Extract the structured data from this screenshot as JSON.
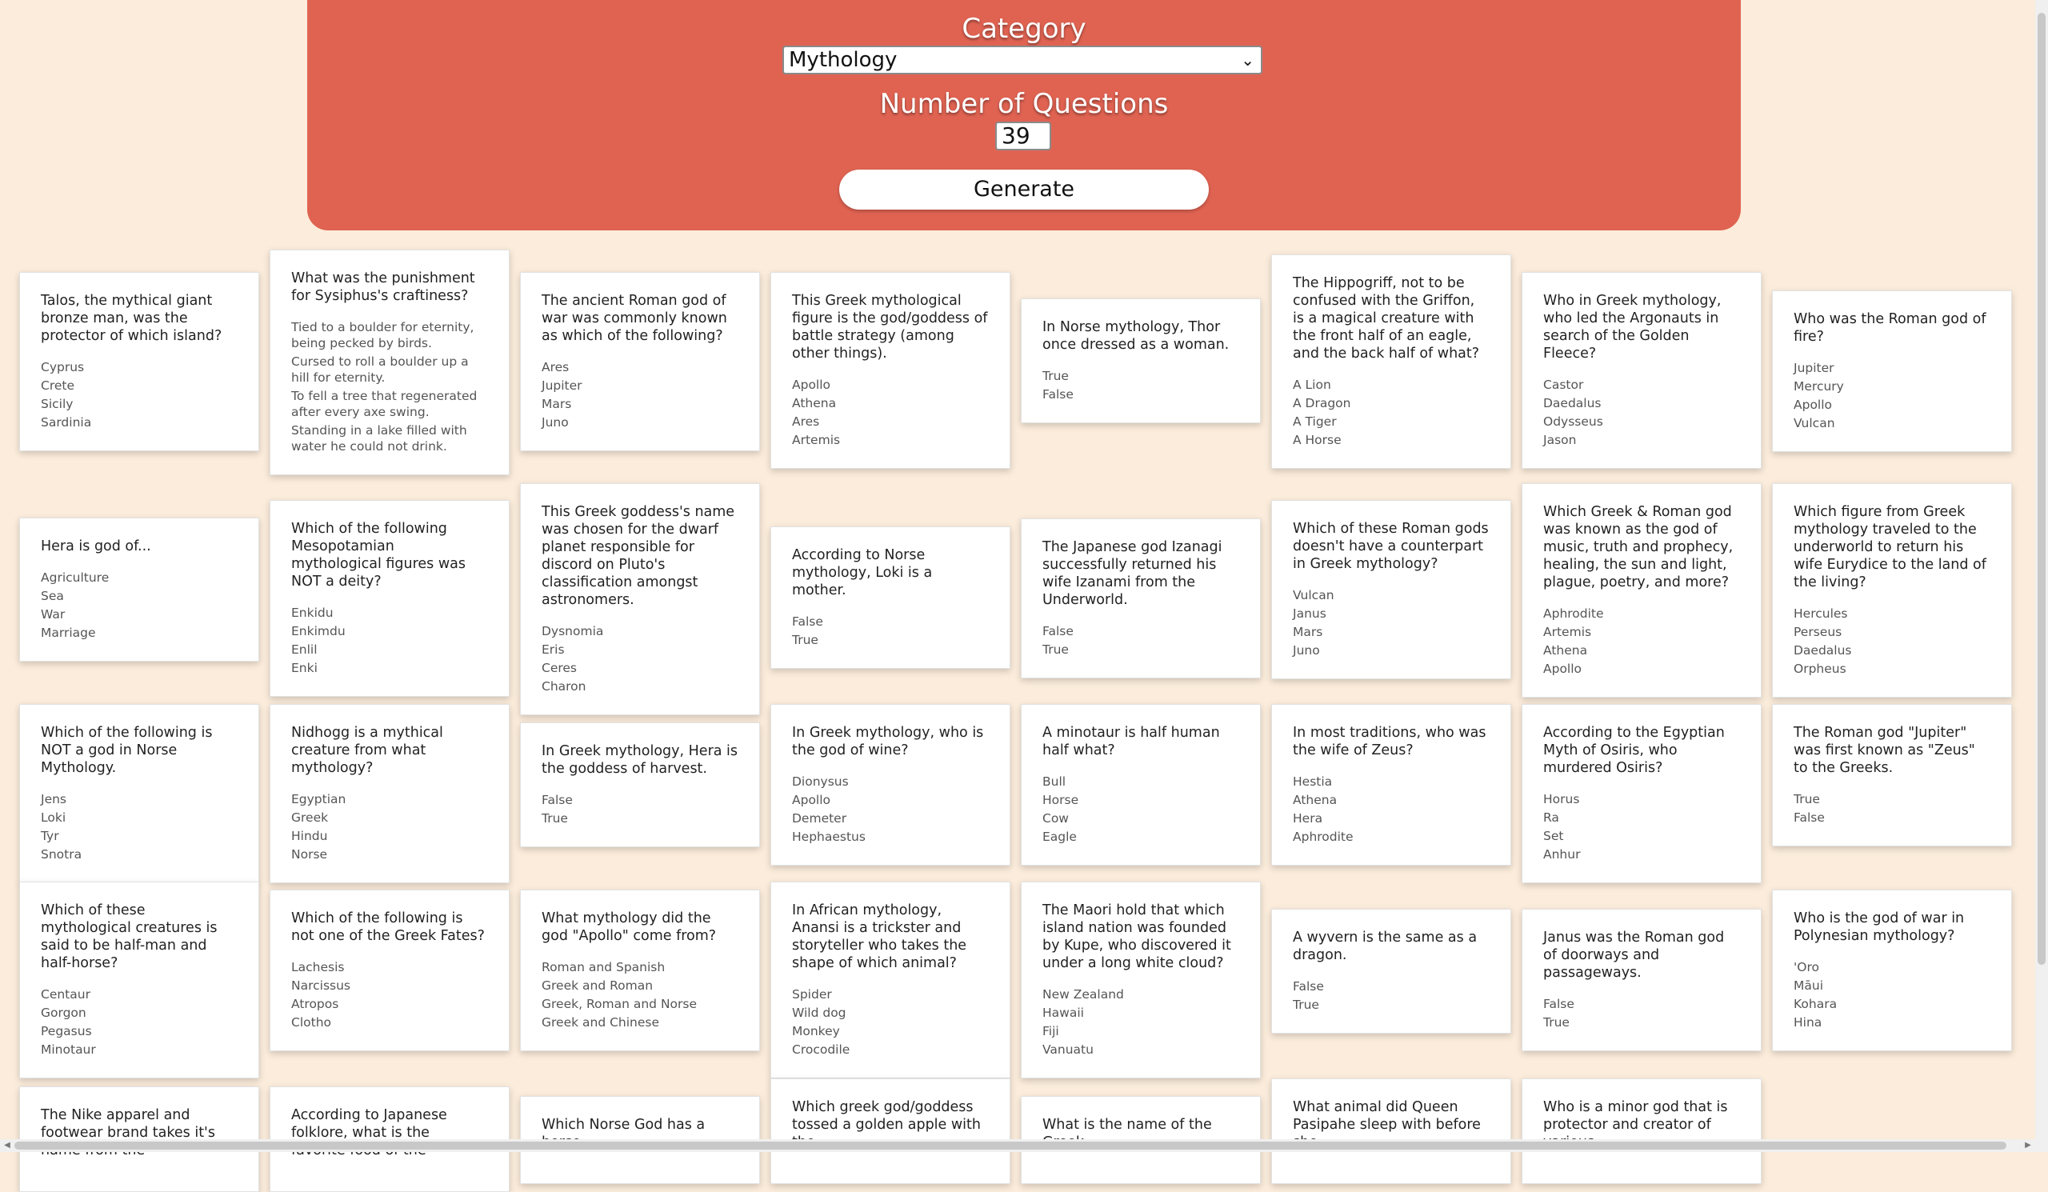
{
  "header": {
    "category_label": "Category",
    "category_value": "Mythology",
    "count_label": "Number of Questions",
    "count_value": "39",
    "generate_label": "Generate"
  },
  "cards": [
    {
      "q": "Talos, the mythical giant bronze man, was the protector of which island?",
      "a": [
        "Cyprus",
        "Crete",
        "Sicily",
        "Sardinia"
      ]
    },
    {
      "q": "What was the punishment for Sysiphus's craftiness?",
      "a": [
        "Tied to a boulder for eternity, being pecked by birds.",
        "Cursed to roll a boulder up a hill for eternity.",
        "To fell a tree that regenerated after every axe swing.",
        "Standing in a lake filled with water he could not drink."
      ]
    },
    {
      "q": "The ancient Roman god of war was commonly known as which of the following?",
      "a": [
        "Ares",
        "Jupiter",
        "Mars",
        "Juno"
      ]
    },
    {
      "q": "This Greek mythological figure is the god/goddess of battle strategy (among other things).",
      "a": [
        "Apollo",
        "Athena",
        "Ares",
        "Artemis"
      ]
    },
    {
      "q": "In Norse mythology, Thor once dressed as a woman.",
      "a": [
        "True",
        "False"
      ]
    },
    {
      "q": "The Hippogriff, not to be confused with the Griffon, is a magical creature with the front half of an eagle, and the back half of what?",
      "a": [
        "A Lion",
        "A Dragon",
        "A Tiger",
        "A Horse"
      ]
    },
    {
      "q": "Who in Greek mythology, who led the Argonauts in search of the Golden Fleece?",
      "a": [
        "Castor",
        "Daedalus",
        "Odysseus",
        "Jason"
      ]
    },
    {
      "q": "Who was the Roman god of fire?",
      "a": [
        "Jupiter",
        "Mercury",
        "Apollo",
        "Vulcan"
      ]
    },
    {
      "q": "Hera is god of...",
      "a": [
        "Agriculture",
        "Sea",
        "War",
        "Marriage"
      ]
    },
    {
      "q": "Which of the following Mesopotamian mythological figures was NOT a deity?",
      "a": [
        "Enkidu",
        "Enkimdu",
        "Enlil",
        "Enki"
      ]
    },
    {
      "q": "This Greek goddess's name was chosen for the dwarf planet responsible for discord on Pluto's classification amongst astronomers.",
      "a": [
        "Dysnomia",
        "Eris",
        "Ceres",
        "Charon"
      ]
    },
    {
      "q": "According to Norse mythology, Loki is a mother.",
      "a": [
        "False",
        "True"
      ]
    },
    {
      "q": "The Japanese god Izanagi successfully returned his wife Izanami from the Underworld.",
      "a": [
        "False",
        "True"
      ]
    },
    {
      "q": "Which of these Roman gods doesn't have a counterpart in Greek mythology?",
      "a": [
        "Vulcan",
        "Janus",
        "Mars",
        "Juno"
      ]
    },
    {
      "q": "Which Greek & Roman god was known as the god of music, truth and prophecy, healing, the sun and light, plague, poetry, and more?",
      "a": [
        "Aphrodite",
        "Artemis",
        "Athena",
        "Apollo"
      ]
    },
    {
      "q": "Which figure from Greek mythology traveled to the underworld to return his wife Eurydice to the land of the living?",
      "a": [
        "Hercules",
        "Perseus",
        "Daedalus",
        "Orpheus"
      ]
    },
    {
      "q": "Which of the following is NOT a god in Norse Mythology.",
      "a": [
        "Jens",
        "Loki",
        "Tyr",
        "Snotra"
      ]
    },
    {
      "q": "Nidhogg is a mythical creature from what mythology?",
      "a": [
        "Egyptian",
        "Greek",
        "Hindu",
        "Norse"
      ]
    },
    {
      "q": "In Greek mythology, Hera is the goddess of harvest.",
      "a": [
        "False",
        "True"
      ]
    },
    {
      "q": "In Greek mythology, who is the god of wine?",
      "a": [
        "Dionysus",
        "Apollo",
        "Demeter",
        "Hephaestus"
      ]
    },
    {
      "q": "A minotaur is half human half what?",
      "a": [
        "Bull",
        "Horse",
        "Cow",
        "Eagle"
      ]
    },
    {
      "q": "In most traditions, who was the wife of Zeus?",
      "a": [
        "Hestia",
        "Athena",
        "Hera",
        "Aphrodite"
      ]
    },
    {
      "q": "According to the Egyptian Myth of Osiris, who murdered Osiris?",
      "a": [
        "Horus",
        "Ra",
        "Set",
        "Anhur"
      ]
    },
    {
      "q": "The Roman god \"Jupiter\" was first known as \"Zeus\" to the Greeks.",
      "a": [
        "True",
        "False"
      ]
    },
    {
      "q": "Which of these mythological creatures is said to be half-man and half-horse?",
      "a": [
        "Centaur",
        "Gorgon",
        "Pegasus",
        "Minotaur"
      ]
    },
    {
      "q": "Which of the following is not one of the Greek Fates?",
      "a": [
        "Lachesis",
        "Narcissus",
        "Atropos",
        "Clotho"
      ]
    },
    {
      "q": "What mythology did the god \"Apollo\" come from?",
      "a": [
        "Roman and Spanish",
        "Greek and Roman",
        "Greek, Roman and Norse",
        "Greek and Chinese"
      ]
    },
    {
      "q": "In African mythology, Anansi is a trickster and storyteller who takes the shape of which animal?",
      "a": [
        "Spider",
        "Wild dog",
        "Monkey",
        "Crocodile"
      ]
    },
    {
      "q": "The Maori hold that which island nation was founded by Kupe, who discovered it under a long white cloud?",
      "a": [
        "New Zealand",
        "Hawaii",
        "Fiji",
        "Vanuatu"
      ]
    },
    {
      "q": "A wyvern is the same as a dragon.",
      "a": [
        "False",
        "True"
      ]
    },
    {
      "q": "Janus was the Roman god of doorways and passageways.",
      "a": [
        "False",
        "True"
      ]
    },
    {
      "q": "Who is the god of war in Polynesian mythology?",
      "a": [
        "'Oro",
        "Māui",
        "Kohara",
        "Hina"
      ]
    },
    {
      "q": "The Nike apparel and footwear brand takes it's name from the",
      "a": []
    },
    {
      "q": "According to Japanese folklore, what is the favorite food of the",
      "a": []
    },
    {
      "q": "Which Norse God has a horse",
      "a": []
    },
    {
      "q": "Which greek god/goddess tossed a golden apple with the",
      "a": []
    },
    {
      "q": "What is the name of the Greek",
      "a": []
    },
    {
      "q": "What animal did Queen Pasipahe sleep with before she",
      "a": []
    },
    {
      "q": "Who is a minor god that is protector and creator of various",
      "a": []
    }
  ]
}
